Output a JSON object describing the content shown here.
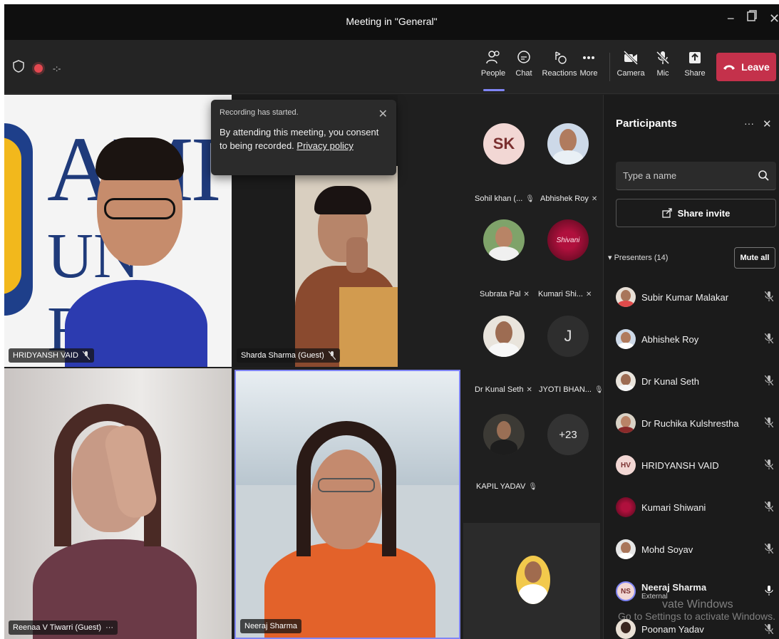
{
  "window": {
    "title": "Meeting in \"General\"",
    "controls": [
      "minimize",
      "restore",
      "close"
    ]
  },
  "toolbar": {
    "left_icons": [
      "shield-icon",
      "recording-icon",
      "more-options-icon"
    ],
    "buttons": [
      {
        "label": "People",
        "icon": "people-icon",
        "active": true
      },
      {
        "label": "Chat",
        "icon": "chat-icon"
      },
      {
        "label": "Reactions",
        "icon": "reactions-icon"
      },
      {
        "label": "More",
        "icon": "more-icon"
      },
      {
        "label": "Camera",
        "icon": "camera-off-icon"
      },
      {
        "label": "Mic",
        "icon": "mic-off-icon"
      },
      {
        "label": "Share",
        "icon": "share-icon"
      }
    ],
    "leave_label": "Leave",
    "colors": {
      "leave": "#c4314b",
      "accent": "#7f85f5"
    }
  },
  "toast": {
    "title": "Recording has started.",
    "message": "By attending this meeting, you consent to being recorded.",
    "link": "Privacy policy"
  },
  "video_tiles": [
    {
      "name": "HRIDYANSH VAID",
      "muted": true
    },
    {
      "name": "Sharda Sharma (Guest)",
      "muted": true
    },
    {
      "name": "Reenaa V Tiwarri (Guest)",
      "more": "···"
    },
    {
      "name": "Neeraj Sharma",
      "speaking": true
    }
  ],
  "gallery": {
    "items": [
      {
        "label": "Sohil khan (...",
        "initials": "SK",
        "mic": "on"
      },
      {
        "label": "Abhishek Roy",
        "mic": "off"
      },
      {
        "label": "Subrata Pal",
        "mic": "off"
      },
      {
        "label": "Kumari Shi...",
        "overlay": "Shivani",
        "mic": "off"
      },
      {
        "label": "Dr Kunal Seth",
        "mic": "off"
      },
      {
        "label": "JYOTI BHAN...",
        "initials": "J",
        "mic": "on"
      },
      {
        "label": "KAPIL YADAV",
        "mic": "on"
      }
    ],
    "overflow": "+23"
  },
  "participants": {
    "title": "Participants",
    "search_placeholder": "Type a name",
    "invite_label": "Share invite",
    "presenters_label": "Presenters (14)",
    "mute_all_label": "Mute all",
    "list": [
      {
        "name": "Subir Kumar Malakar",
        "mic": "off"
      },
      {
        "name": "Abhishek Roy",
        "mic": "off"
      },
      {
        "name": "Dr Kunal Seth",
        "mic": "off"
      },
      {
        "name": "Dr Ruchika Kulshrestha",
        "mic": "off"
      },
      {
        "name": "HRIDYANSH VAID",
        "initials": "HV",
        "mic": "off"
      },
      {
        "name": "Kumari Shiwani",
        "mic": "off"
      },
      {
        "name": "Mohd Soyav",
        "mic": "off"
      },
      {
        "name": "Neeraj Sharma",
        "initials": "NS",
        "sub": "External",
        "mic": "on"
      },
      {
        "name": "Poonam Yadav",
        "mic": "off"
      }
    ]
  },
  "watermark": {
    "line1": "vate Windows",
    "line2": "Go to Settings to activate Windows."
  }
}
